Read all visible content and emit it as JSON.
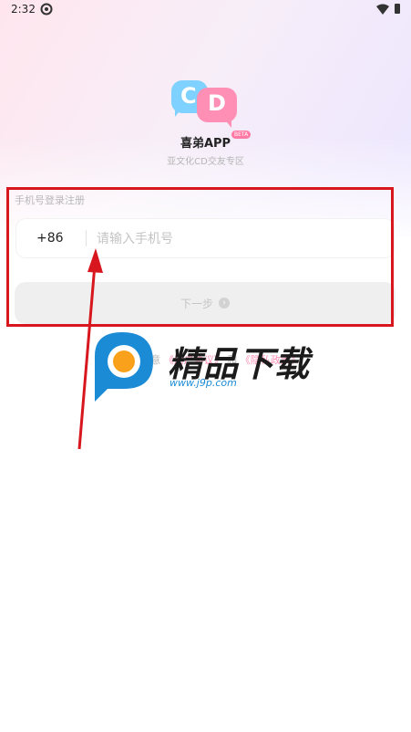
{
  "status_bar": {
    "time": "2:32",
    "sync_icon": "sync-icon",
    "wifi_icon": "wifi-icon",
    "battery_icon": "battery-icon"
  },
  "brand": {
    "logo_letters": [
      "C",
      "D"
    ],
    "app_name": "喜弟APP",
    "badge": "BETA",
    "slogan": "亚文化CD交友专区",
    "colors": {
      "cyan": "#7fd2ff",
      "pink": "#ff8fb4"
    }
  },
  "login": {
    "section_title": "手机号登录注册",
    "country_code": "+86",
    "phone_placeholder": "请输入手机号",
    "phone_value": "",
    "next_label": "下一步",
    "next_icon": "chevron-right-icon"
  },
  "agreement": {
    "prefix": "阅读并同意",
    "link1": "《用户协议》",
    "middle": "和",
    "link2": "《隐私政策》"
  },
  "annotation": {
    "highlight_color": "#d7161d"
  },
  "watermark": {
    "title": "精品下载",
    "url": "www.j9p.com",
    "colors": {
      "blue": "#1c8bd6",
      "orange": "#f9a11b"
    }
  }
}
